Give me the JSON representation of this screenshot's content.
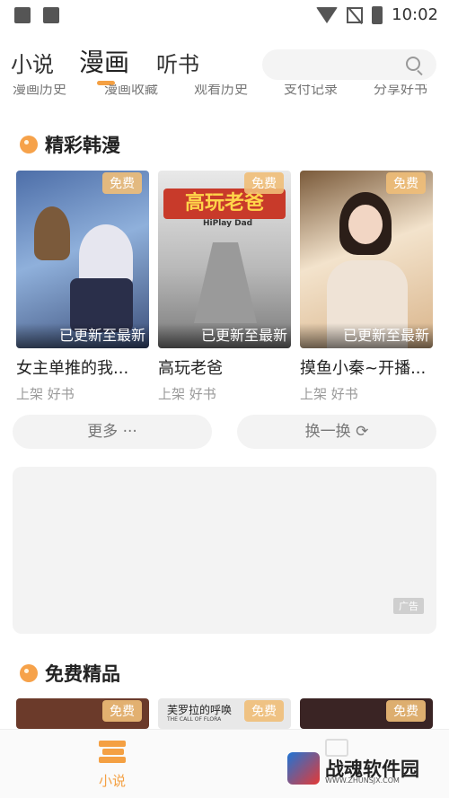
{
  "status_bar": {
    "time": "10:02",
    "icons": [
      "gallery-icon",
      "font-icon",
      "wifi-icon",
      "no-signal-icon",
      "battery-charging-icon"
    ]
  },
  "top_tabs": [
    {
      "label": "小说",
      "active": false
    },
    {
      "label": "漫画",
      "active": true
    },
    {
      "label": "听书",
      "active": false
    }
  ],
  "search": {
    "placeholder": "",
    "icon": "search-icon"
  },
  "sub_nav": [
    "漫画历史",
    "漫画收藏",
    "观看历史",
    "支付记录",
    "分享好书"
  ],
  "section1": {
    "title": "精彩韩漫",
    "items": [
      {
        "badge": "免费",
        "status": "已更新至最新",
        "title": "女主单推的我...",
        "meta": "上架 好书"
      },
      {
        "badge": "免费",
        "status": "已更新至最新",
        "title": "高玩老爸",
        "meta": "上架 好书",
        "cover_text": "高玩老爸",
        "cover_sub": "HiPlay Dad"
      },
      {
        "badge": "免费",
        "status": "已更新至最新",
        "title": "摸鱼小秦~开播...",
        "meta": "上架 好书"
      }
    ],
    "more_label": "更多 ···",
    "refresh_label": "换一换 ⟳"
  },
  "ad": {
    "label": "广告"
  },
  "section2": {
    "title": "免费精品",
    "items": [
      {
        "badge": "免费"
      },
      {
        "badge": "免费",
        "cover_text": "芙罗拉的呼唤",
        "cover_sub": "THE CALL OF FLORA"
      },
      {
        "badge": "免费"
      }
    ]
  },
  "bottom_nav": {
    "items": [
      {
        "label": "小说",
        "icon": "books-icon"
      },
      {
        "label": "",
        "icon": "gift-icon"
      }
    ]
  },
  "watermark": {
    "text": "战魂软件园",
    "sub": "WWW.ZHUNSJX.COM"
  },
  "colors": {
    "accent": "#f4a043",
    "badge": "#f0be78"
  }
}
